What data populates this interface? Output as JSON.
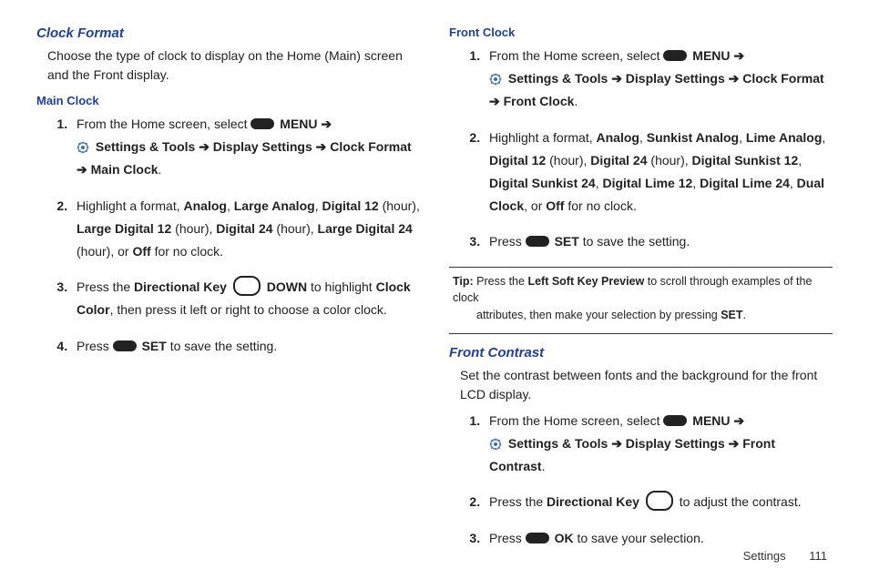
{
  "left": {
    "heading": "Clock Format",
    "intro": "Choose the type of clock to display on the Home (Main) screen and the Front display.",
    "sub1": "Main Clock",
    "mc_s1_a": "From the Home screen, select ",
    "mc_s1_menu": "MENU",
    "mc_s1_arrow": " ➔",
    "mc_s1_b": "Settings & Tools ➔ Display Settings ➔ Clock Format ➔ Main Clock",
    "mc_s1_period": ".",
    "mc_s2_a": "Highlight a format, ",
    "mc_s2_f1": "Analog",
    "mc_s2_c1": ", ",
    "mc_s2_f2": "Large Analog",
    "mc_s2_c2": ", ",
    "mc_s2_f3": "Digital 12",
    "mc_s2_h1": " (hour), ",
    "mc_s2_f4": "Large Digital 12",
    "mc_s2_h2": " (hour), ",
    "mc_s2_f5": "Digital 24",
    "mc_s2_h3": " (hour), ",
    "mc_s2_f6": "Large Digital 24",
    "mc_s2_h4": " (hour), or ",
    "mc_s2_f7": "Off",
    "mc_s2_end": " for no clock.",
    "mc_s3_a": "Press the ",
    "mc_s3_dk": "Directional Key",
    "mc_s3_down": "DOWN",
    "mc_s3_b": " to highlight ",
    "mc_s3_cc": "Clock Color",
    "mc_s3_c": ", then press it left or right to choose a color clock.",
    "mc_s4_a": "Press ",
    "mc_s4_set": "SET",
    "mc_s4_b": " to save the setting."
  },
  "right": {
    "sub1": "Front Clock",
    "fc_s1_a": "From the Home screen, select ",
    "fc_s1_menu": "MENU",
    "fc_s1_arrow": " ➔",
    "fc_s1_b": "Settings & Tools ➔ Display Settings ➔ Clock Format ➔ Front Clock",
    "fc_s1_period": ".",
    "fc_s2_a": "Highlight a format, ",
    "fc_s2_f1": "Analog",
    "fc_s2_c1": ", ",
    "fc_s2_f2": "Sunkist Analog",
    "fc_s2_c2": ", ",
    "fc_s2_f3": "Lime Analog",
    "fc_s2_c3": ", ",
    "fc_s2_f4": "Digital 12",
    "fc_s2_h1": " (hour), ",
    "fc_s2_f5": "Digital 24",
    "fc_s2_h2": " (hour), ",
    "fc_s2_f6": "Digital Sunkist 12",
    "fc_s2_c4": ", ",
    "fc_s2_f7": "Digital Sunkist 24",
    "fc_s2_c5": ", ",
    "fc_s2_f8": "Digital Lime 12",
    "fc_s2_c6": ", ",
    "fc_s2_f9": "Digital Lime 24",
    "fc_s2_c7": ", ",
    "fc_s2_f10": "Dual Clock",
    "fc_s2_c8": ", or ",
    "fc_s2_f11": "Off",
    "fc_s2_end": " for no clock.",
    "fc_s3_a": "Press ",
    "fc_s3_set": "SET",
    "fc_s3_b": " to save the setting.",
    "tip_label": "Tip:",
    "tip_a": " Press the ",
    "tip_lsk": "Left Soft Key Preview",
    "tip_b": " to scroll through examples of the clock",
    "tip_c": "attributes, then make your selection by pressing ",
    "tip_set": "SET",
    "tip_period": ".",
    "heading2": "Front Contrast",
    "intro2": "Set the contrast between fonts and the background for the front LCD display.",
    "fct_s1_a": "From the Home screen, select ",
    "fct_s1_menu": "MENU",
    "fct_s1_arrow": " ➔",
    "fct_s1_b": "Settings & Tools ➔ Display Settings ➔ Front Contrast",
    "fct_s1_period": ".",
    "fct_s2_a": "Press the ",
    "fct_s2_dk": "Directional Key",
    "fct_s2_b": " to adjust the contrast.",
    "fct_s3_a": "Press ",
    "fct_s3_ok": "OK",
    "fct_s3_b": " to save your selection."
  },
  "footer": {
    "section": "Settings",
    "page": "111"
  }
}
